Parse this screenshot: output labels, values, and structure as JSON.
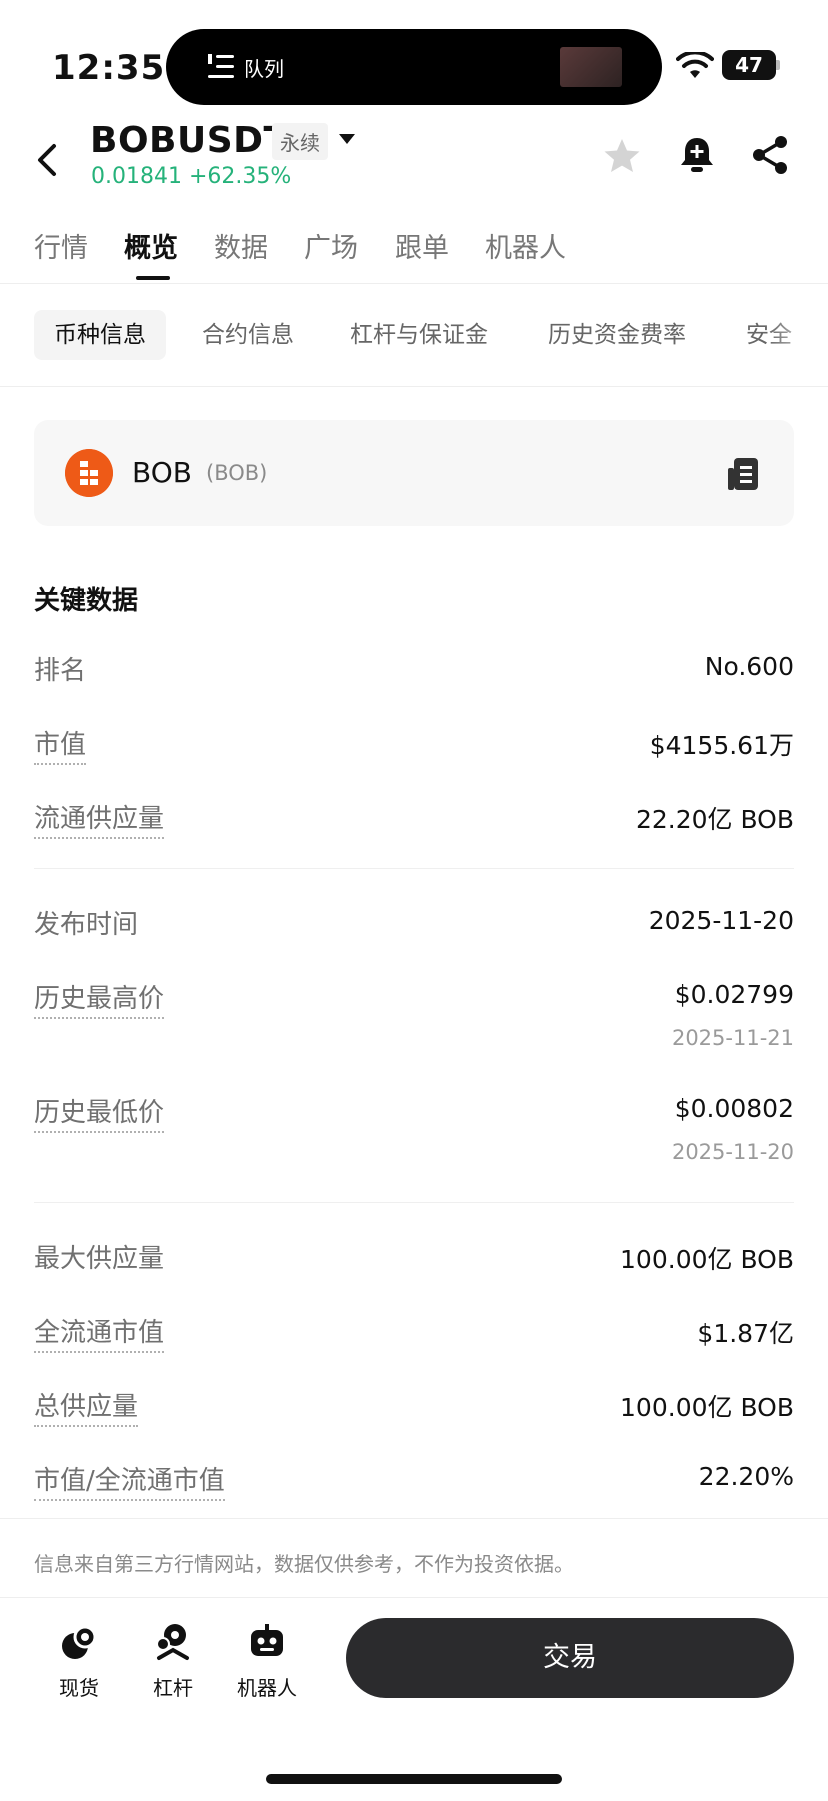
{
  "status_bar": {
    "time": "12:35",
    "island_label": "队列",
    "battery": "47"
  },
  "header": {
    "symbol": "BOBUSDT",
    "contract_type": "永续",
    "price_line": "0.01841 +62.35%",
    "price_color": "#25b27a"
  },
  "tabs": [
    "行情",
    "概览",
    "数据",
    "广场",
    "跟单",
    "机器人"
  ],
  "active_tab": "概览",
  "subtabs": [
    "币种信息",
    "合约信息",
    "杠杆与保证金",
    "历史资金费率",
    "安全"
  ],
  "active_subtab": "币种信息",
  "coin": {
    "name": "BOB",
    "symbol": "(BOB)",
    "logo_color": "#ee5a17"
  },
  "key_data": {
    "title": "关键数据",
    "rows": [
      {
        "label": "排名",
        "value": "No.600"
      },
      {
        "label": "市值",
        "value": "$4155.61万"
      },
      {
        "label": "流通供应量",
        "value": "22.20亿 BOB"
      },
      {
        "label": "发布时间",
        "value": "2025-11-20"
      },
      {
        "label": "历史最高价",
        "value": "$0.02799",
        "sub": "2025-11-21"
      },
      {
        "label": "历史最低价",
        "value": "$0.00802",
        "sub": "2025-11-20"
      },
      {
        "label": "最大供应量",
        "value": "100.00亿 BOB"
      },
      {
        "label": "全流通市值",
        "value": "$1.87亿"
      },
      {
        "label": "总供应量",
        "value": "100.00亿 BOB"
      },
      {
        "label": "市值/全流通市值",
        "value": "22.20%"
      }
    ]
  },
  "disclaimer": "信息来自第三方行情网站，数据仅供参考，不作为投资依据。",
  "bottom_nav": [
    {
      "label": "现货",
      "icon": "spot-icon"
    },
    {
      "label": "杠杆",
      "icon": "margin-icon"
    },
    {
      "label": "机器人",
      "icon": "robot-icon"
    }
  ],
  "trade_button": "交易"
}
